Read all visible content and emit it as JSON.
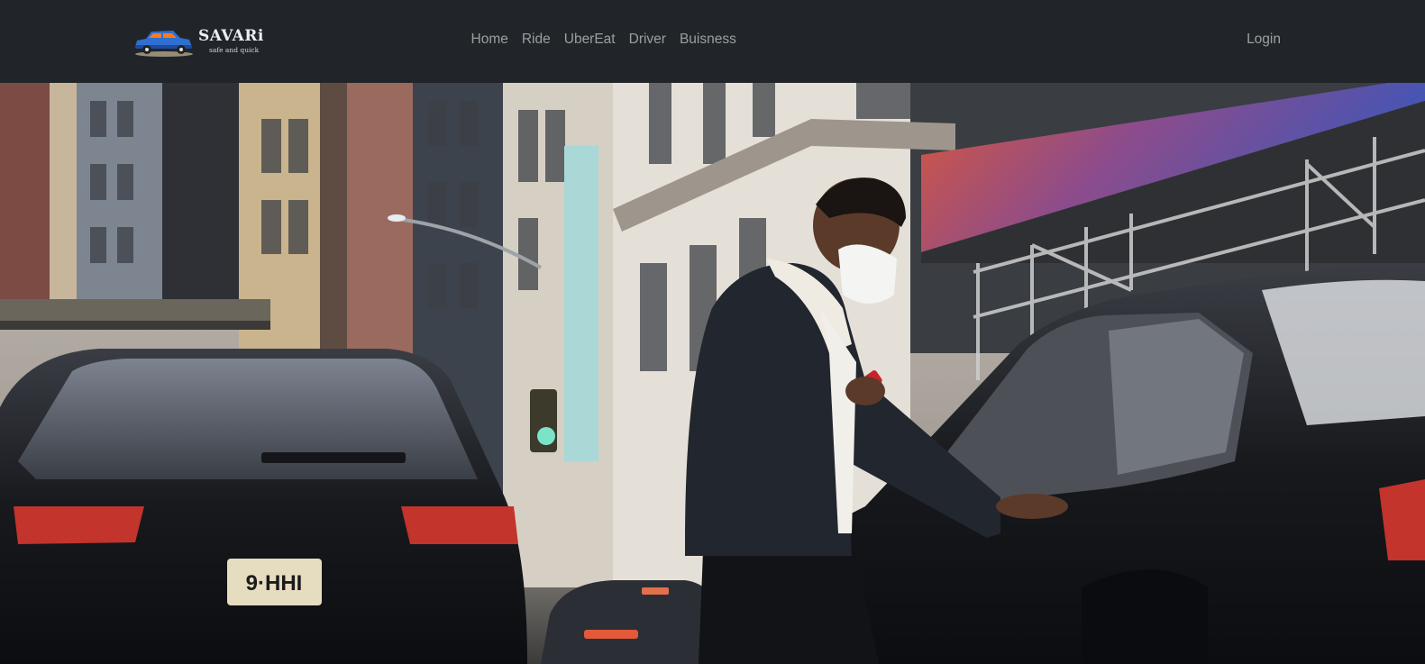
{
  "brand": {
    "name": "SAVARi",
    "tagline": "safe and quick",
    "logo_icon": "car-icon",
    "logo_color": "#2f6fd0"
  },
  "nav": {
    "items": [
      {
        "label": "Home"
      },
      {
        "label": "Ride"
      },
      {
        "label": "UberEat"
      },
      {
        "label": "Driver"
      },
      {
        "label": "Buisness"
      }
    ],
    "login_label": "Login"
  },
  "hero": {
    "image": "street-scene-man-opening-car-door",
    "plate_text": "9·HHI"
  },
  "colors": {
    "navbar_bg": "#212529",
    "nav_text": "#9aa0a6",
    "awning_start": "#d9583a",
    "awning_end": "#3e56b8"
  }
}
